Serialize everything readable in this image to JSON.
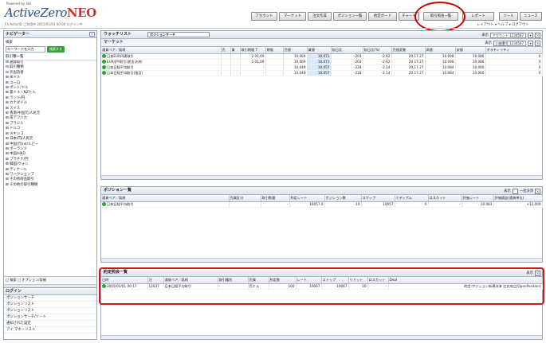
{
  "header": {
    "logo_small": "Powered by SBI",
    "logo_main": "ActiveZero",
    "logo_neo": "NEO",
    "tagline_left": "FX Activ/ID ご利用中 2015/01/01 00:00 ログイン中",
    "tagline_right": "口座番号 0000 0000 ご利用時間 00:00:00",
    "top_buttons": [
      "アカウント",
      "マーケット",
      "注文作成",
      "ポジション一覧",
      "約定ボード",
      "チャート",
      "取引照会一覧",
      "レポート",
      "ツール",
      "ニュース"
    ],
    "toolbar2": "レイアウト ▾ ヘルプ ▾ ログアウト"
  },
  "left_panel": {
    "title": "ナビゲーター",
    "search_label": "検索",
    "search_value": "キーワードを入力",
    "search_button": "検索する",
    "tree_label": "取引種一覧",
    "tree_items": [
      "⊟ 通貨取引",
      "⊟ 取引種類",
      "⊟ 外国為替",
      "  ⊞ 米ドル",
      "  ⊞ ユーロ",
      "  ⊞ ポンド/ドル",
      "  ⊞ 豪ドル・NZドル",
      "  ⊞ ランド/円",
      "  ⊞ カナダドル",
      "  ⊞ スイス",
      "  ⊞ 香港/中国元/人民元",
      "  ⊞ 南アフリカ",
      "  ⊞ ブラジル",
      "  ⊞ トルコ",
      "  ⊞ メキシコ",
      "  ⊞ 日本/円/人民元",
      "  ⊞ 中国/元Ind/ルピー",
      "  ⊞ ポーランド",
      "  ⊞ 中国/HKD",
      "  ⊞ プラチナ/円",
      "  ⊞ 韓国/ウォン",
      "  ⊞ ディナール",
      "  ⊞ ワークショップ",
      "  ⊞ その他商品取引",
      "⊞ その他の取引種類"
    ],
    "tree_bottom": "□ 検索 □ オプション/詳細",
    "bottom_title": "ログイン",
    "bottom_items": [
      "ポジションサーチ",
      "ポジションリスト",
      "ポジションリスト",
      "ポジションサーチ/ソート",
      "通知された設定",
      "アイ マネーリスト"
    ]
  },
  "watchlist": {
    "title": "ウォッチリスト",
    "selector": "ポジションサーチ",
    "subtitle": "マーケット",
    "right_label": "表示",
    "right_sel1": "アカウント 1234567",
    "right_sel2": "口座番号 1234567",
    "columns": [
      "通貨ペア／銘柄",
      "売",
      "買",
      "取引期間 T",
      "期限",
      "売値",
      "買値",
      "前日比",
      "前日比(%)",
      "売値変動",
      "高値",
      "安値",
      "ボラティリティ"
    ],
    "rows": [
      [
        "日本EUR円建取引",
        "",
        "",
        "2.01.09",
        "",
        "10.069",
        "10.071",
        "-203",
        "-2.62",
        "20.17.27",
        "10.098",
        "10.086",
        "0"
      ],
      [
        "EUR/JPY取引(差金決済)",
        "",
        "",
        "2.01.09",
        "",
        "10.069",
        "10.071",
        "-203",
        "-2.62",
        "20.17.27",
        "10.098",
        "10.086",
        "0"
      ],
      [
        "日本日経平均取引",
        "",
        "",
        "-",
        "",
        "10.049",
        "10.057",
        "-228",
        "-2.14",
        "20.17.27",
        "10.084",
        "10.060",
        "0"
      ],
      [
        "日本日経平均取引(限月)",
        "",
        "",
        "-",
        "",
        "10.049",
        "10.057",
        "-228",
        "-2.14",
        "20.17.27",
        "10.084",
        "10.060",
        "0"
      ]
    ]
  },
  "positions": {
    "title": "ポジション一覧",
    "right_label": "表示",
    "right_check": "一括決済",
    "columns": [
      "通貨ペア／銘柄",
      "売買区分",
      "取引数量",
      "約定レート",
      "ポジション数",
      "スワップ",
      "ミディアム",
      "ロスカット",
      "評価レート",
      "評価損益(通貨単位)"
    ],
    "rows": [
      [
        "日本日経平均取引",
        "",
        "-",
        "10057.0",
        "10",
        "10057",
        "0",
        "-",
        "10.083",
        "+12,000"
      ]
    ]
  },
  "orders": {
    "title": "約定照会一覧",
    "right_label": "表示",
    "columns": [
      "日時",
      "注",
      "通貨ペア／銘柄",
      "取引種別",
      "売買",
      "約定数",
      "レート",
      "ストップ",
      "リミット",
      "ロスカット",
      "Deal"
    ],
    "rows": [
      [
        "2015/01/01 00:17",
        "12037",
        "日本日経平均取引",
        "-",
        "売ドル",
        "100",
        "10067",
        "10067",
        "10",
        "-",
        "約定-ポジション新規決済 注文成立(OpenPosition)"
      ]
    ]
  }
}
